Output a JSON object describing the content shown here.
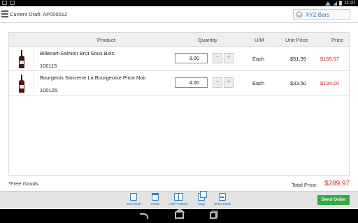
{
  "status_bar": {
    "time": "11:01"
  },
  "header": {
    "draft_label": "Current Draft: AP000012",
    "account_name": "XYZ Bars"
  },
  "table": {
    "columns": [
      "Product",
      "Quantity",
      "U/M",
      "Unit Price",
      "Price"
    ],
    "rows": [
      {
        "name": "Billecart-Salmon Brut Sous Bois",
        "code": "100115",
        "quantity": "3.00",
        "um": "Each",
        "unit_price": "$51.99",
        "price": "$155.97"
      },
      {
        "name": "Bourgeois Sancerre La Bourgeoise Pinot Noir",
        "code": "100125",
        "quantity": "4.00",
        "um": "Each",
        "unit_price": "$33.50",
        "price": "$134.00"
      }
    ],
    "stepper_minus": "−",
    "stepper_plus": "+"
  },
  "footer": {
    "free_goods": "*Free Goods",
    "total_label": "Total Price:",
    "total_value": "$289.97"
  },
  "actions": [
    {
      "label": "Save Draft",
      "icon": "save-icon"
    },
    {
      "label": "Delete",
      "icon": "trash-icon"
    },
    {
      "label": "Add Products",
      "icon": "book-icon"
    },
    {
      "label": "Copy",
      "icon": "copy-icon"
    },
    {
      "label": "Order Detail",
      "icon": "detail-icon"
    }
  ],
  "send_order_label": "Send Order",
  "colors": {
    "accent": "#2f7fc4",
    "price_red": "#c62828",
    "send_green": "#3aa843"
  }
}
